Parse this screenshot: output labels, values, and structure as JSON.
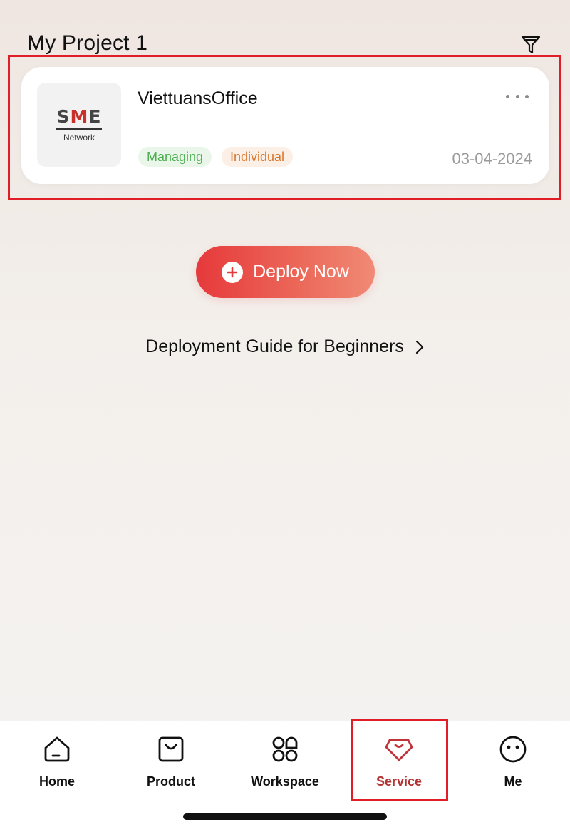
{
  "header": {
    "title": "My Project 1",
    "filter_icon": "filter-icon"
  },
  "project": {
    "logo": {
      "text_main_left": "S",
      "text_main_mid": "M",
      "text_main_right": "E",
      "text_sub": "Network"
    },
    "name": "ViettuansOffice",
    "badges": [
      "Managing",
      "Individual"
    ],
    "date": "03-04-2024",
    "more_icon": "more-horizontal-icon"
  },
  "actions": {
    "deploy_label": "Deploy Now",
    "guide_label": "Deployment Guide for Beginners"
  },
  "tabbar": {
    "items": [
      {
        "label": "Home",
        "icon": "home-icon"
      },
      {
        "label": "Product",
        "icon": "shopping-bag-icon"
      },
      {
        "label": "Workspace",
        "icon": "grid-icon"
      },
      {
        "label": "Service",
        "icon": "gem-icon",
        "active": true
      },
      {
        "label": "Me",
        "icon": "smiley-icon"
      }
    ]
  },
  "colors": {
    "accent": "#e6393b",
    "active_tab": "#b33232",
    "highlight": "#e01e27",
    "badge_green": "#4caf50",
    "badge_orange": "#d9772d"
  }
}
